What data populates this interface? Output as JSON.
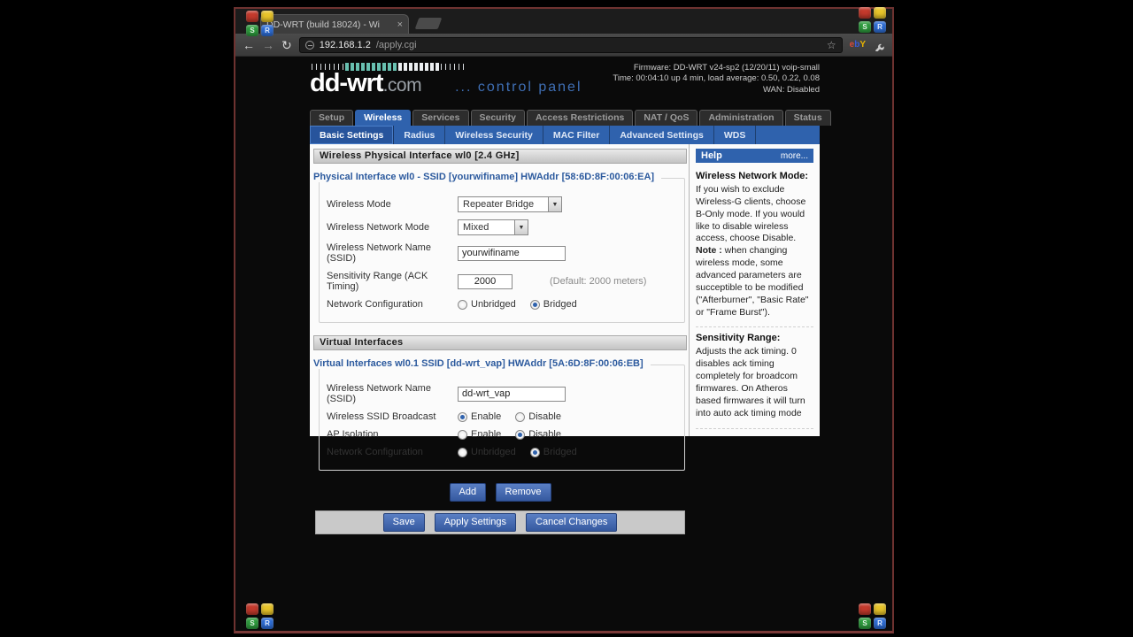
{
  "browser": {
    "tab_title": "DD-WRT (build 18024) - Wi",
    "close_glyph": "×",
    "back_glyph": "←",
    "forward_glyph": "→",
    "reload_glyph": "↻",
    "url_host": "192.168.1.2",
    "url_path": "/apply.cgi",
    "star_glyph": "☆",
    "ebay": {
      "e": "e",
      "b": "b",
      "y": "Y"
    }
  },
  "masthead": {
    "logo": "dd-wrt",
    "logo_tld": ".com",
    "tagline": "... control panel",
    "firmware": "Firmware: DD-WRT v24-sp2 (12/20/11) voip-small",
    "time": "Time: 00:04:10 up 4 min, load average: 0.50, 0.22, 0.08",
    "wan": "WAN: Disabled"
  },
  "nav": {
    "tabs": [
      {
        "label": "Setup"
      },
      {
        "label": "Wireless"
      },
      {
        "label": "Services"
      },
      {
        "label": "Security"
      },
      {
        "label": "Access Restrictions"
      },
      {
        "label": "NAT / QoS"
      },
      {
        "label": "Administration"
      },
      {
        "label": "Status"
      }
    ]
  },
  "subnav": {
    "tabs": [
      {
        "label": "Basic Settings"
      },
      {
        "label": "Radius"
      },
      {
        "label": "Wireless Security"
      },
      {
        "label": "MAC Filter"
      },
      {
        "label": "Advanced Settings"
      },
      {
        "label": "WDS"
      }
    ]
  },
  "glyphs": {
    "dropdown": "▼"
  },
  "physical": {
    "section_title": "Wireless Physical Interface wl0 [2.4 GHz]",
    "legend": "Physical Interface wl0 - SSID [yourwifiname] HWAddr [58:6D:8F:00:06:EA]",
    "wireless_mode": {
      "label": "Wireless Mode",
      "value": "Repeater Bridge"
    },
    "network_mode": {
      "label": "Wireless Network Mode",
      "value": "Mixed"
    },
    "ssid": {
      "label": "Wireless Network Name (SSID)",
      "value": "yourwifiname"
    },
    "ack": {
      "label": "Sensitivity Range (ACK Timing)",
      "value": "2000",
      "note": "(Default: 2000 meters)"
    },
    "netconfig": {
      "label": "Network Configuration",
      "options": [
        "Unbridged",
        "Bridged"
      ],
      "selected": "Bridged"
    }
  },
  "virtual": {
    "section_title": "Virtual Interfaces",
    "legend": "Virtual Interfaces wl0.1 SSID [dd-wrt_vap] HWAddr [5A:6D:8F:00:06:EB]",
    "ssid": {
      "label": "Wireless Network Name (SSID)",
      "value": "dd-wrt_vap"
    },
    "broadcast": {
      "label": "Wireless SSID Broadcast",
      "options": [
        "Enable",
        "Disable"
      ],
      "selected": "Enable"
    },
    "isolation": {
      "label": "AP Isolation",
      "options": [
        "Enable",
        "Disable"
      ],
      "selected": "Disable"
    },
    "netconfig": {
      "label": "Network Configuration",
      "options": [
        "Unbridged",
        "Bridged"
      ],
      "selected": "Bridged"
    },
    "add_label": "Add",
    "remove_label": "Remove"
  },
  "actions": {
    "save": "Save",
    "apply": "Apply Settings",
    "cancel": "Cancel Changes"
  },
  "help": {
    "title": "Help",
    "more": "more...",
    "s1_title": "Wireless Network Mode:",
    "s1_body": "If you wish to exclude Wireless-G clients, choose B-Only mode. If you would like to disable wireless access, choose Disable.",
    "s1_note_label": "Note :",
    "s1_note": " when changing wireless mode, some advanced parameters are succeptible to be modified (\"Afterburner\", \"Basic Rate\" or \"Frame Burst\").",
    "s2_title": "Sensitivity Range:",
    "s2_body": "Adjusts the ack timing. 0 disables ack timing completely for broadcom firmwares. On Atheros based firmwares it will turn into auto ack timing mode"
  },
  "watermark": {
    "letters": [
      "",
      "",
      "S",
      "R"
    ]
  }
}
